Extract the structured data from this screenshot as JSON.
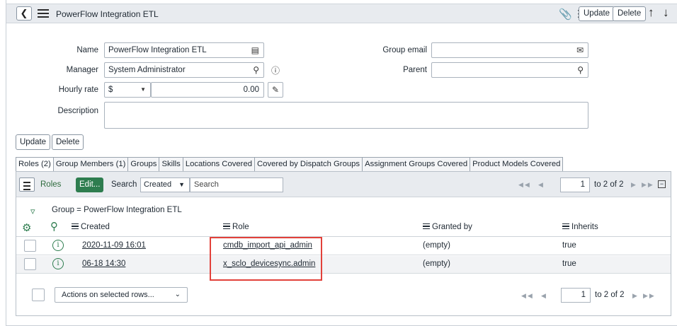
{
  "header": {
    "title": "PowerFlow Integration ETL",
    "update_label": "Update",
    "delete_label": "Delete",
    "more_label": "ooo"
  },
  "form": {
    "name_label": "Name",
    "name_value": "PowerFlow Integration ETL",
    "manager_label": "Manager",
    "manager_value": "System Administrator",
    "hourly_label": "Hourly rate",
    "currency_value": "$",
    "rate_value": "0.00",
    "description_label": "Description",
    "description_value": "",
    "group_email_label": "Group email",
    "group_email_value": "",
    "parent_label": "Parent",
    "parent_value": ""
  },
  "buttons": {
    "update": "Update",
    "delete": "Delete"
  },
  "tabs": [
    "Roles (2)",
    "Group Members (1)",
    "Groups",
    "Skills",
    "Locations Covered",
    "Covered by Dispatch Groups",
    "Assignment Groups Covered",
    "Product Models Covered"
  ],
  "related_list": {
    "roles_label": "Roles",
    "edit_label": "Edit...",
    "search_label": "Search",
    "search_field": "Created",
    "search_placeholder": "Search",
    "page_value": "1",
    "range_text": "to 2 of 2",
    "breadcrumb": "Group = PowerFlow Integration ETL",
    "columns": {
      "created": "Created",
      "role": "Role",
      "granted_by": "Granted by",
      "inherits": "Inherits"
    },
    "rows": [
      {
        "created": "2020-11-09 16:01",
        "role": "cmdb_import_api_admin",
        "granted_by": "(empty)",
        "inherits": "true"
      },
      {
        "created": "06-18 14:30",
        "role": "x_sclo_devicesync.admin",
        "granted_by": "(empty)",
        "inherits": "true"
      }
    ],
    "actions_placeholder": "Actions on selected rows...",
    "footer_page_value": "1",
    "footer_range_text": "to 2 of 2"
  },
  "colors": {
    "accent_green": "#2e7d4f",
    "highlight_red": "#e2413a",
    "header_bg": "#e8ebef"
  }
}
